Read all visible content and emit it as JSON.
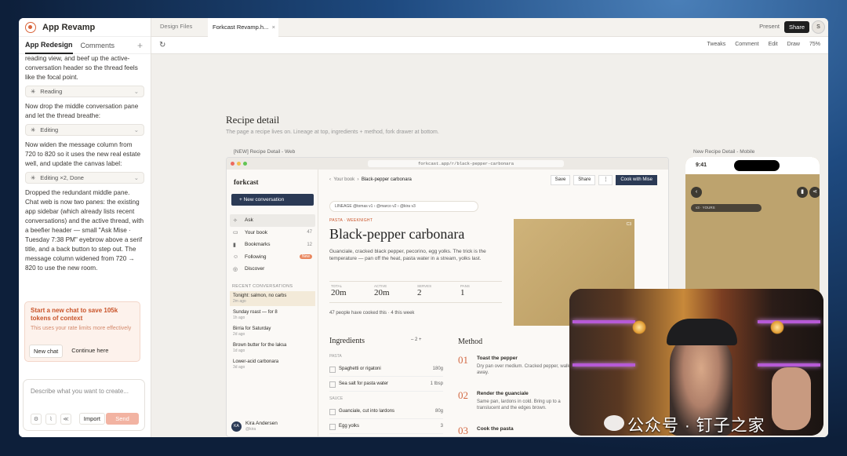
{
  "app": {
    "title": "App Revamp",
    "tabs": [
      "App Redesign",
      "Comments"
    ],
    "add": "+"
  },
  "chat": {
    "p0": "reading view, and beef up the active-conversation header so the thread feels like the focal point.",
    "pill1": "Reading",
    "p1": "Now drop the middle conversation pane and let the thread breathe:",
    "pill2": "Editing",
    "p2": "Now widen the message column from 720 to 820 so it uses the new real estate well, and update the canvas label:",
    "pill3": "Editing ×2, Done",
    "p3": "Dropped the redundant middle pane. Chat web is now two panes: the existing app sidebar (which already lists recent conversations) and the active thread, with a beefier header — small \"Ask Mise · Tuesday 7:38 PM\" eyebrow above a serif title, and a back button to step out. The message column widened from 720 → 820 to use the new room."
  },
  "warning": {
    "title": "Start a new chat to save 105k tokens of context",
    "sub": "This uses your rate limits more effectively",
    "new_chat": "New chat",
    "continue": "Continue here"
  },
  "composer": {
    "placeholder": "Describe what you want to create...",
    "import": "Import",
    "send": "Send"
  },
  "tabsbar": {
    "tab1": "Design Files",
    "tab2": "Forkcast Revamp.h...",
    "close": "×",
    "present": "Present",
    "share": "Share",
    "avatar": "S"
  },
  "toolbar": {
    "tweaks": "Tweaks",
    "comment": "Comment",
    "edit": "Edit",
    "draw": "Draw",
    "zoom": "75%"
  },
  "canvas": {
    "title": "Recipe detail",
    "subtitle": "The page a recipe lives on. Lineage at top, ingredients + method, fork drawer at bottom.",
    "web_label": "[NEW] Recipe Detail - Web",
    "mobile_label": "New Recipe Detail - Mobile"
  },
  "web": {
    "url": "forkcast.app/r/black-pepper-carbonara",
    "brand": "forkcast",
    "new_conv": "+ New conversation",
    "nav": [
      {
        "label": "Ask",
        "count": ""
      },
      {
        "label": "Your book",
        "count": "47"
      },
      {
        "label": "Bookmarks",
        "count": "12"
      },
      {
        "label": "Following",
        "count": "New"
      },
      {
        "label": "Discover",
        "count": ""
      }
    ],
    "recent_header": "RECENT CONVERSATIONS",
    "recent": [
      {
        "t": "Tonight: salmon, no carbs",
        "a": "2m ago"
      },
      {
        "t": "Sunday roast — for 8",
        "a": "1h ago"
      },
      {
        "t": "Birria for Saturday",
        "a": "2d ago"
      },
      {
        "t": "Brown butter for the laksa",
        "a": "1d ago"
      },
      {
        "t": "Lower-acid carbonara",
        "a": "3d ago"
      }
    ],
    "user": "Kira Andersen",
    "user_handle": "@kira",
    "user_initials": "KA",
    "crumb_back": "Your book",
    "crumb_cur": "Black-pepper carbonara",
    "save": "Save",
    "share": "Share",
    "more": "⋮",
    "cook": "Cook with Mise",
    "lineage": "LINEAGE  @tomas  v1  ›  @marco  v2  ›  @kira  v3",
    "kicker": "PASTA · WEEKNIGHT",
    "title": "Black-pepper carbonara",
    "desc": "Guanciale, cracked black pepper, pecorino, egg yolks. The trick is the temperature — pan off the heat, pasta water in a stream, yolks last.",
    "stats": [
      {
        "l": "TOTAL",
        "v": "20m"
      },
      {
        "l": "ACTIVE",
        "v": "20m"
      },
      {
        "l": "SERVES",
        "v": "2"
      },
      {
        "l": "PANS",
        "v": "1"
      }
    ],
    "cooked": "47 people have cooked this · 4 this week",
    "img_tag": "C3",
    "ingredients": "Ingredients",
    "servings": "2",
    "pasta_sec": "PASTA",
    "sauce_sec": "SAUCE",
    "rows": [
      {
        "n": "Spaghetti or rigatoni",
        "q": "180g"
      },
      {
        "n": "Sea salt for pasta water",
        "q": "1 tbsp"
      },
      {
        "n": "Guanciale, cut into lardons",
        "q": "80g"
      },
      {
        "n": "Egg yolks",
        "q": "3"
      }
    ],
    "method": "Method",
    "steps": [
      {
        "n": "01",
        "h": "Toast the pepper",
        "d": "Dry pan over medium. Cracked pepper, walk away."
      },
      {
        "n": "02",
        "h": "Render the guanciale",
        "d": "Same pan, lardons in cold. Bring up to a translucent and the edges brown."
      },
      {
        "n": "03",
        "h": "Cook the pasta",
        "d": ""
      }
    ]
  },
  "mobile": {
    "time": "9:41",
    "lineage": "v3 · YOURS"
  },
  "watermark": "公众号 · 钉子之家"
}
